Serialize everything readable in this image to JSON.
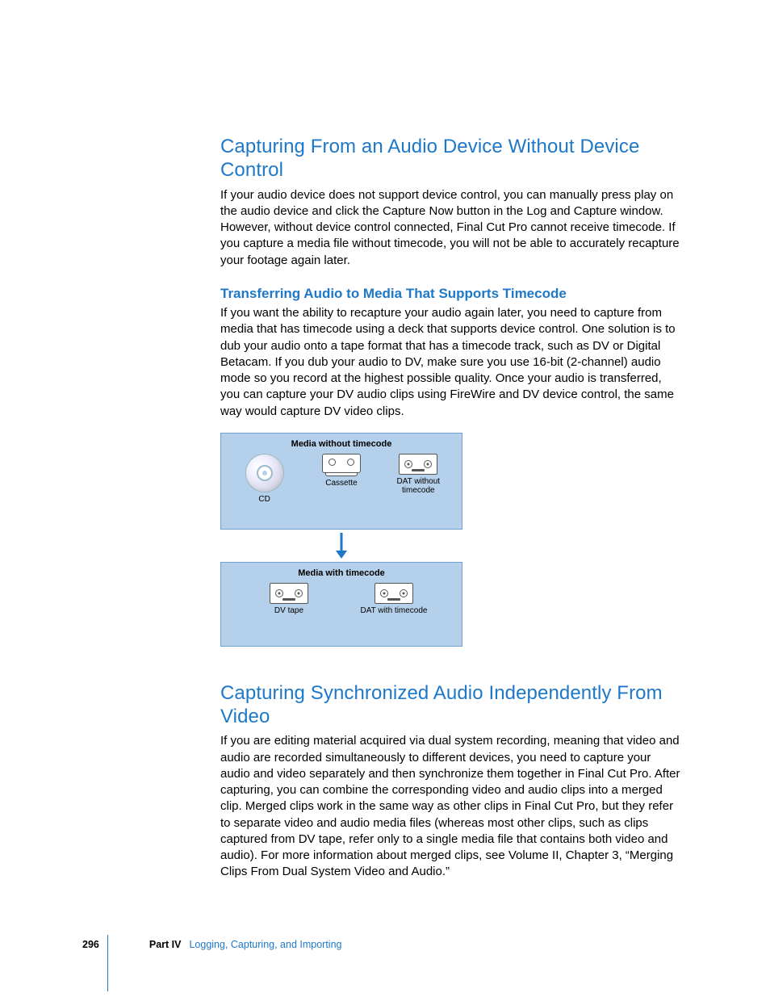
{
  "section1": {
    "heading": "Capturing From an Audio Device Without Device Control",
    "body": "If your audio device does not support device control, you can manually press play on the audio device and click the Capture Now button in the Log and Capture window. However, without device control connected, Final Cut Pro cannot receive timecode. If you capture a media file without timecode, you will not be able to accurately recapture your footage again later.",
    "sub": {
      "heading": "Transferring Audio to Media That Supports Timecode",
      "body": "If you want the ability to recapture your audio again later, you need to capture from media that has timecode using a deck that supports device control. One solution is to dub your audio onto a tape format that has a timecode track, such as DV or Digital Betacam. If you dub your audio to DV, make sure you use 16-bit (2-channel) audio mode so you record at the highest possible quality. Once your audio is transferred, you can capture your DV audio clips using FireWire and DV device control, the same way would capture DV video clips."
    }
  },
  "diagram": {
    "topTitle": "Media without timecode",
    "items_top": {
      "cd": "CD",
      "cassette": "Cassette",
      "dat": "DAT without timecode"
    },
    "bottomTitle": "Media with timecode",
    "items_bottom": {
      "dvtape": "DV tape",
      "dat": "DAT with timecode"
    }
  },
  "section2": {
    "heading": "Capturing Synchronized Audio Independently From Video",
    "body": "If you are editing material acquired via dual system recording, meaning that video and audio are recorded simultaneously to different devices, you need to capture your audio and video separately and then synchronize them together in Final Cut Pro. After capturing, you can combine the corresponding video and audio clips into a merged clip. Merged clips work in the same way as other clips in Final Cut Pro, but they refer to separate video and audio media files (whereas most other clips, such as clips captured from DV tape, refer only to a single media file that contains both video and audio). For more information about merged clips, see Volume II, Chapter 3, “Merging Clips From Dual System Video and Audio.”"
  },
  "footer": {
    "page": "296",
    "part": "Part IV",
    "section": "Logging, Capturing, and Importing"
  }
}
